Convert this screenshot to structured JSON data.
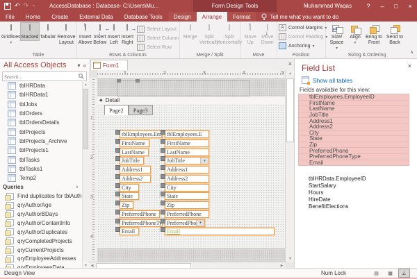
{
  "icons": {
    "caret-down": "▾",
    "undo": "↶",
    "redo": "↷",
    "qat-more": "⌄",
    "win-min": "–",
    "win-max": "□",
    "win-close": "×",
    "help": "?",
    "collapse-left": "«",
    "header-caret": "▾",
    "group-collapse": "∧",
    "scroll-up": "▲",
    "scroll-down": "▼",
    "scroll-left": "◀",
    "scroll-right": "▶",
    "detail-marker": "◆",
    "arrow-up": "↑",
    "arrow-down": "↓",
    "arrow-left": "←",
    "arrow-right": "→",
    "size-space": "⇄",
    "letter-a": "A",
    "ribbon-collapse": "∧",
    "view-form": "▤",
    "view-layout": "▦",
    "view-design": "∠",
    "close-x": "×"
  },
  "titlebar": {
    "title": "AccessDatabase : Database- C:\\Users\\Mu...",
    "tools": "Form Design Tools",
    "user": "Muhammad Waqas"
  },
  "ribbon": {
    "tabs": {
      "file": "File",
      "home": "Home",
      "create": "Create",
      "external": "External Data",
      "dbtools": "Database Tools",
      "design": "Design",
      "arrange": "Arrange",
      "format": "Format"
    },
    "tellme": "Tell me what you want to do",
    "table_group": {
      "label": "Table",
      "gridlines": "Gridlines",
      "stacked": "Stacked",
      "tabular": "Tabular",
      "remove_layout": "Remove Layout"
    },
    "rows_cols": {
      "label": "Rows & Columns",
      "insert_above": "Insert Above",
      "insert_below": "Insert Below",
      "insert_left": "Insert Left",
      "insert_right": "Insert Right",
      "select_layout": "Select Layout",
      "select_column": "Select Column",
      "select_row": "Select Row"
    },
    "merge_split": {
      "label": "Merge / Split",
      "merge": "Merge",
      "split_v": "Split Vertically",
      "split_h": "Split Horizontally"
    },
    "move": {
      "label": "Move",
      "up": "Move Up",
      "down": "Move Down"
    },
    "position": {
      "label": "Position",
      "margins": "Control Margins",
      "padding": "Control Padding",
      "anchoring": "Anchoring"
    },
    "sizing": {
      "label": "Sizing & Ordering",
      "size_space": "Size/ Space",
      "align": "Align",
      "front": "Bring to Front",
      "back": "Send to Back"
    }
  },
  "nav": {
    "title": "All Access Objects",
    "search_placeholder": "Search...",
    "tables": [
      "tblHRData",
      "tblHRData1",
      "tblJobs",
      "tblOrders",
      "tblOrdersDetails",
      "tblProjects",
      "tblProjects_Archive",
      "tblProjects1",
      "tblTasks",
      "tblTasks1",
      "Temp2"
    ],
    "queries_label": "Queries",
    "queries": [
      "Find duplicates for tblAuthors",
      "qryAuthorAge",
      "qryAuthorBDays",
      "qryAuthorContantInfo",
      "qryAuthorDuplicates",
      "qryCompletedProjects",
      "qryCurrentProjects",
      "qryEmployeeAddresses",
      "qryEmployeesData"
    ]
  },
  "document": {
    "tab": "Form1",
    "detail_label": "Detail",
    "ruler_h": [
      "1",
      "2",
      "3",
      "4",
      "5"
    ],
    "ruler_v": [
      "1",
      "2",
      "3",
      "4"
    ],
    "pages": [
      {
        "label": "Page2",
        "active": true
      },
      {
        "label": "Page3"
      }
    ],
    "rows": [
      {
        "label": "tblEmployees.Emp",
        "value": "tblEmployees.E",
        "lw": 62,
        "vw": 64
      },
      {
        "label": "FirstName",
        "value": "FirstName",
        "lw": 43,
        "vw": 64
      },
      {
        "label": "LastName",
        "value": "LastName",
        "lw": 42,
        "vw": 64
      },
      {
        "label": "JobTitle",
        "value": "JobTitle",
        "lw": 35,
        "vw": 64,
        "combo": true
      },
      {
        "label": "Address1",
        "value": "Address1",
        "lw": 45,
        "vw": 64
      },
      {
        "label": "Address2",
        "value": "Address2",
        "lw": 45,
        "vw": 64
      },
      {
        "label": "City",
        "value": "City",
        "lw": 28,
        "vw": 64
      },
      {
        "label": "State",
        "value": "State",
        "lw": 28,
        "vw": 64
      },
      {
        "label": "Zip",
        "value": "Zip",
        "lw": 20,
        "vw": 64
      },
      {
        "label": "PreferredPhone",
        "value": "PreferredPhone",
        "lw": 58,
        "vw": 64
      },
      {
        "label": "PreferredPhoneTyp",
        "value": "PreferredPho",
        "lw": 62,
        "vw": 58,
        "combo": true
      },
      {
        "label": "Email",
        "value": "Email",
        "lw": 28,
        "vw": 158,
        "email": true
      }
    ]
  },
  "field_list": {
    "title": "Field List",
    "show_all": "Show all tables",
    "caption": "Fields available for this view:",
    "highlighted": [
      "tblEmployees.EmployeeID",
      "FirstName",
      "LastName",
      "JobTitle",
      "Address1",
      "Address2",
      "City",
      "State",
      "Zip",
      "PreferredPhone",
      "PreferredPhoneType",
      "Email"
    ],
    "normal": [
      "tblHRData.EmployeeID",
      "StartSalary",
      "Hours",
      "HireDate",
      "BenefitElections"
    ]
  },
  "status": {
    "left": "Design View",
    "numlock": "Num Lock"
  },
  "colors": {
    "accent_red": "#A4373A",
    "selection_orange": "#EE9C45",
    "field_pink": "#F3C7C4",
    "link_blue": "#0563C1",
    "email_green": "#9AAE5C"
  }
}
